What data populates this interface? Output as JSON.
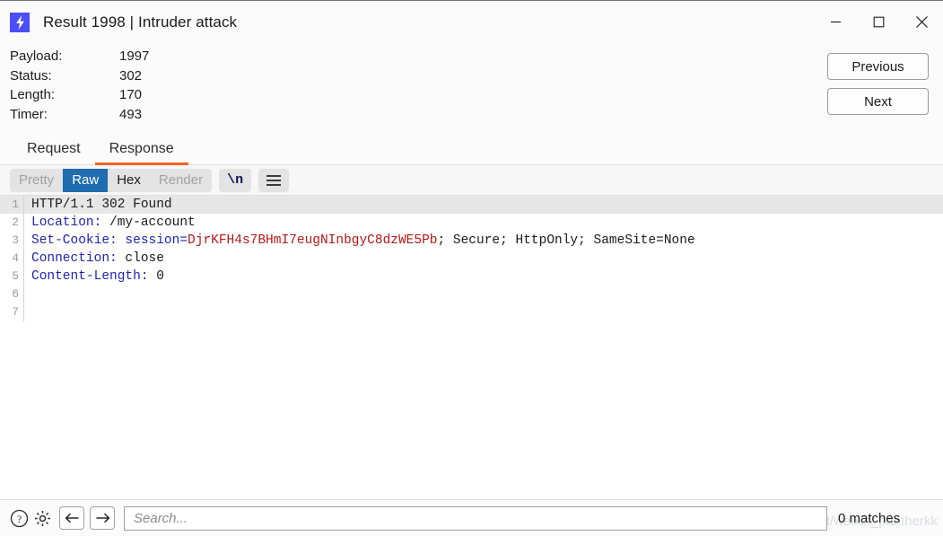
{
  "window": {
    "title": "Result 1998 | Intruder attack",
    "app_icon": "lightning-bolt-icon",
    "controls": {
      "minimize": "minimize-icon",
      "maximize": "maximize-icon",
      "close": "close-icon"
    }
  },
  "details": {
    "rows": [
      {
        "label": "Payload:",
        "value": "1997"
      },
      {
        "label": "Status:",
        "value": "302"
      },
      {
        "label": "Length:",
        "value": "170"
      },
      {
        "label": "Timer:",
        "value": "493"
      }
    ]
  },
  "navigation": {
    "previous_label": "Previous",
    "next_label": "Next"
  },
  "tabs": [
    {
      "label": "Request",
      "active": false
    },
    {
      "label": "Response",
      "active": true
    }
  ],
  "toolbar": {
    "view_modes": [
      {
        "label": "Pretty",
        "state": "disabled"
      },
      {
        "label": "Raw",
        "state": "selected"
      },
      {
        "label": "Hex",
        "state": "normal"
      },
      {
        "label": "Render",
        "state": "disabled"
      }
    ],
    "newline_label": "\\n",
    "menu_icon": "hamburger-menu-icon"
  },
  "editor": {
    "lines": [
      {
        "number": "1",
        "highlighted": true,
        "segments": [
          {
            "text": "HTTP/1.1 302 Found",
            "style": "plain"
          }
        ]
      },
      {
        "number": "2",
        "highlighted": false,
        "segments": [
          {
            "text": "Location:",
            "style": "header-name"
          },
          {
            "text": " /my-account",
            "style": "plain"
          }
        ]
      },
      {
        "number": "3",
        "highlighted": false,
        "segments": [
          {
            "text": "Set-Cookie:",
            "style": "header-name"
          },
          {
            "text": " ",
            "style": "plain"
          },
          {
            "text": "session=",
            "style": "cookie-name"
          },
          {
            "text": "DjrKFH4s7BHmI7eugNInbgyC8dzWE5Pb",
            "style": "cookie-value"
          },
          {
            "text": "; Secure; HttpOnly; SameSite=None",
            "style": "plain"
          }
        ]
      },
      {
        "number": "4",
        "highlighted": false,
        "segments": [
          {
            "text": "Connection:",
            "style": "header-name"
          },
          {
            "text": " close",
            "style": "plain"
          }
        ]
      },
      {
        "number": "5",
        "highlighted": false,
        "segments": [
          {
            "text": "Content-Length:",
            "style": "header-name"
          },
          {
            "text": " 0",
            "style": "plain"
          }
        ]
      },
      {
        "number": "6",
        "highlighted": false,
        "segments": []
      },
      {
        "number": "7",
        "highlighted": false,
        "segments": []
      }
    ]
  },
  "statusbar": {
    "help_icon": "help-icon",
    "settings_icon": "gear-icon",
    "back_icon": "arrow-left-icon",
    "forward_icon": "arrow-right-icon",
    "search_placeholder": "Search...",
    "search_value": "",
    "matches_label": "0 matches",
    "watermark": "https://blog.csdn.net/weixin_pantherkk"
  },
  "colors": {
    "accent_tab": "#f26522",
    "selected_segment": "#1f6cb0",
    "app_icon_bg": "#4d4dfa",
    "header_name": "#2222aa",
    "cookie_value": "#b01818"
  }
}
